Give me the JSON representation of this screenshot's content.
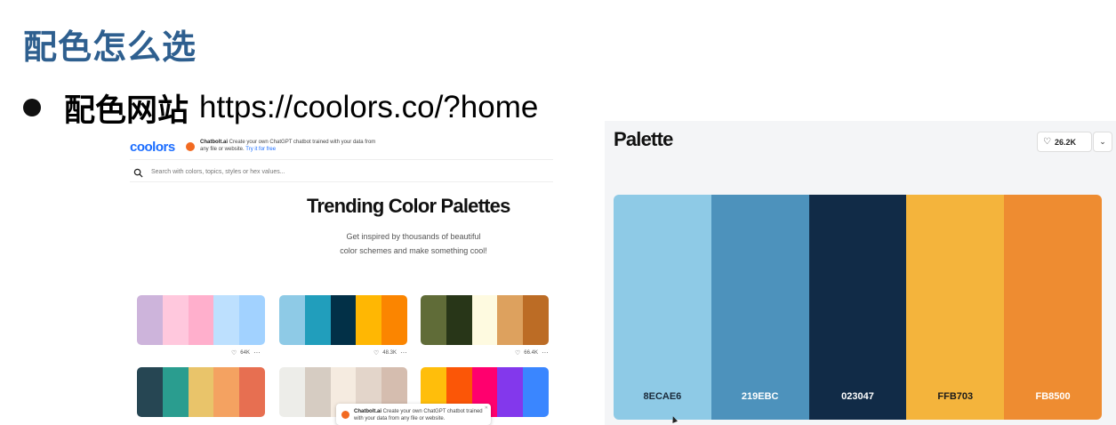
{
  "slide": {
    "title": "配色怎么选",
    "bullet_label": "配色网站",
    "bullet_url": "https://coolors.co/?home"
  },
  "left_site": {
    "logo": "coolors",
    "ad_brand": "Chatbolt.ai",
    "ad_text": "Create your own ChatGPT chatbot trained with your data from any file or website.",
    "ad_cta": "Try it for free",
    "search_placeholder": "Search with colors, topics, styles or hex values...",
    "hero_title": "Trending Color Palettes",
    "hero_sub_line1": "Get inspired by thousands of beautiful",
    "hero_sub_line2": "color schemes and make something cool!",
    "palettes": [
      {
        "colors": [
          "#cdb4db",
          "#ffc8dd",
          "#ffafcc",
          "#bde0fe",
          "#a2d2ff"
        ],
        "likes": "64K"
      },
      {
        "colors": [
          "#8ecae6",
          "#219ebc",
          "#023047",
          "#ffb703",
          "#fb8500"
        ],
        "likes": "48.3K"
      },
      {
        "colors": [
          "#606c38",
          "#283618",
          "#fefae0",
          "#dda15e",
          "#bc6c25"
        ],
        "likes": "66.4K"
      },
      {
        "colors": [
          "#264653",
          "#2a9d8f",
          "#e9c46a",
          "#f4a261",
          "#e76f51"
        ]
      },
      {
        "colors": [
          "#edede9",
          "#d6ccc2",
          "#f5ebe0",
          "#e3d5ca",
          "#d5bdaf"
        ]
      },
      {
        "colors": [
          "#ffbe0b",
          "#fb5607",
          "#ff006e",
          "#8338ec",
          "#3a86ff"
        ]
      }
    ],
    "popup_brand": "Chatbolt.ai",
    "popup_text": "Create your own ChatGPT chatbot trained with your data from any file or website."
  },
  "right_site": {
    "title": "Palette",
    "likes": "26.2K",
    "colors": [
      {
        "hex": "#8ECAE6",
        "label": "8ECAE6",
        "text_color": "#1a2a3a"
      },
      {
        "hex": "#4D92BC",
        "label": "219EBC",
        "text_color": "#ffffff"
      },
      {
        "hex": "#112B47",
        "label": "023047",
        "text_color": "#ffffff"
      },
      {
        "hex": "#F4B43C",
        "label": "FFB703",
        "text_color": "#1a1a1a"
      },
      {
        "hex": "#EE8C31",
        "label": "FB8500",
        "text_color": "#ffffff"
      }
    ],
    "icons": {
      "heart": "heart-icon",
      "dropdown": "chevron-down-icon",
      "cursor": "mouse-cursor-icon",
      "search": "search-icon"
    }
  }
}
